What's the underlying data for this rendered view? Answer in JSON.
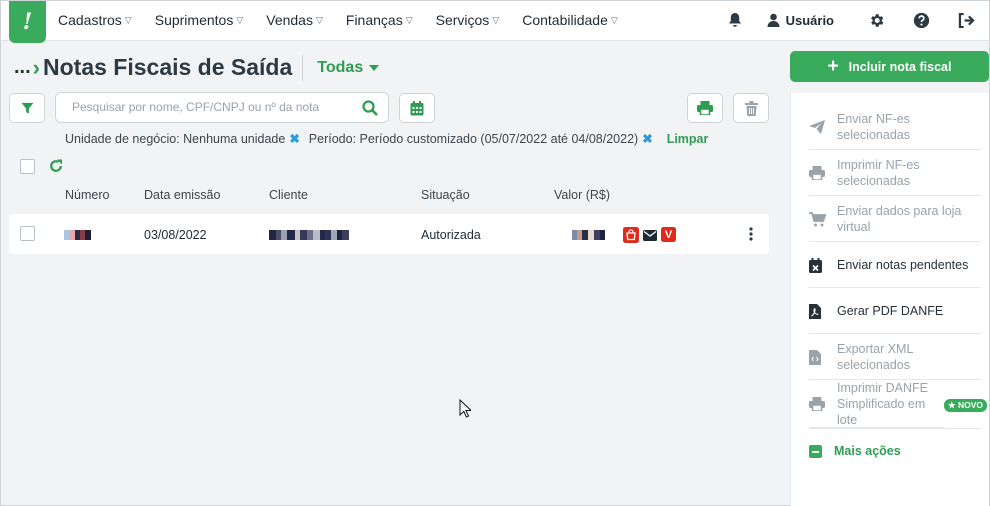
{
  "app": {
    "logo_letter": "!"
  },
  "nav": {
    "items": [
      {
        "label": "Cadastros"
      },
      {
        "label": "Suprimentos"
      },
      {
        "label": "Vendas"
      },
      {
        "label": "Finanças"
      },
      {
        "label": "Serviços"
      },
      {
        "label": "Contabilidade"
      }
    ],
    "user_label": "Usuário"
  },
  "page": {
    "breadcrumb_dots": "...",
    "title": "Notas Fiscais de Saída",
    "filter_label": "Todas"
  },
  "search": {
    "placeholder": "Pesquisar por nome, CPF/CNPJ ou nº da nota"
  },
  "active_filters": {
    "unit": "Unidade de negócio: Nenhuma unidade",
    "period": "Período: Período customizado (05/07/2022 até 04/08/2022)",
    "clear_label": "Limpar"
  },
  "table": {
    "columns": [
      "Número",
      "Data emissão",
      "Cliente",
      "Situação",
      "Valor (R$)"
    ],
    "rows": [
      {
        "data_emissao": "03/08/2022",
        "situacao": "Autorizada",
        "badge_v": "V"
      }
    ]
  },
  "sidebar": {
    "include_label": "Incluir nota fiscal",
    "actions": [
      {
        "label": "Enviar NF-es selecionadas",
        "icon": "send-icon",
        "enabled": false
      },
      {
        "label": "Imprimir NF-es selecionadas",
        "icon": "print-icon",
        "enabled": false
      },
      {
        "label": "Enviar dados para loja virtual",
        "icon": "cart-icon",
        "enabled": false
      },
      {
        "label": "Enviar notas pendentes",
        "icon": "calendar-x-icon",
        "enabled": true
      },
      {
        "label": "Gerar PDF DANFE",
        "icon": "pdf-icon",
        "enabled": true
      },
      {
        "label": "Exportar XML selecionados",
        "icon": "xml-file-icon",
        "enabled": false
      },
      {
        "label": "Imprimir DANFE Simplificado em lote",
        "icon": "print-icon",
        "enabled": false
      }
    ],
    "novo_badge": "★ NOVO",
    "more_label": "Mais ações"
  },
  "colors": {
    "brand": "#3aaa5c",
    "link": "#2e9cd6",
    "danger": "#e02a1b"
  }
}
